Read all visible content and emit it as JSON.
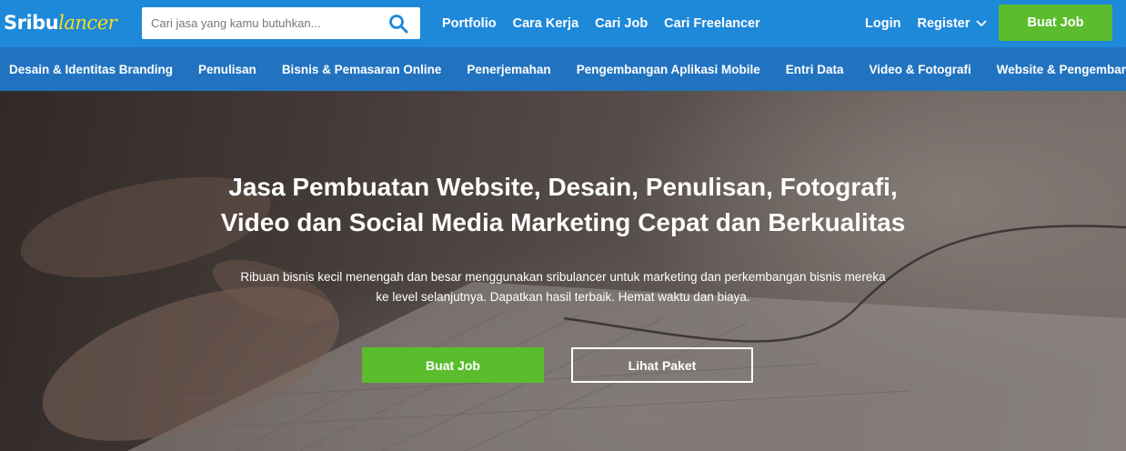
{
  "brand": {
    "logo_part1": "Sribu",
    "logo_part2": "lancer"
  },
  "search": {
    "placeholder": "Cari jasa yang kamu butuhkan..."
  },
  "nav": {
    "links": [
      "Portfolio",
      "Cara Kerja",
      "Cari Job",
      "Cari Freelancer"
    ]
  },
  "account": {
    "login": "Login",
    "register": "Register",
    "post_job": "Buat Job"
  },
  "categories": [
    "Desain & Identitas Branding",
    "Penulisan",
    "Bisnis & Pemasaran Online",
    "Penerjemahan",
    "Pengembangan Aplikasi Mobile",
    "Entri Data",
    "Video & Fotografi",
    "Website & Pengembangan"
  ],
  "hero": {
    "title_line1": "Jasa Pembuatan Website, Desain, Penulisan, Fotografi,",
    "title_line2": "Video dan Social Media Marketing Cepat dan Berkualitas",
    "subtitle_line1": "Ribuan bisnis kecil menengah dan besar menggunakan sribulancer untuk marketing dan perkembangan bisnis mereka",
    "subtitle_line2": "ke level selanjutnya. Dapatkan hasil terbaik. Hemat waktu dan biaya.",
    "primary_button": "Buat Job",
    "secondary_button": "Lihat Paket"
  },
  "colors": {
    "topbar": "#1e88d9",
    "catbar": "#2173c0",
    "accent_green": "#5bbd2e",
    "logo_yellow": "#f5e11c"
  },
  "icons": {
    "search": "search-icon",
    "register_dropdown": "chevron-down-icon"
  }
}
